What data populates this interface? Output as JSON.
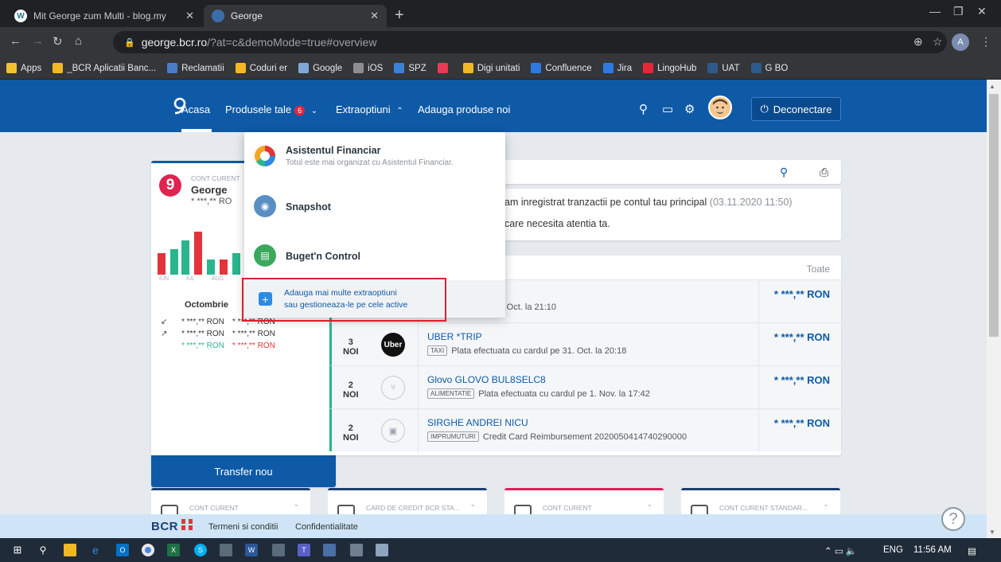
{
  "browser": {
    "tabs": [
      {
        "title": "Mit George zum Multi - blog.my",
        "active": false
      },
      {
        "title": "George",
        "active": true
      }
    ],
    "url_host": "george.bcr.ro",
    "url_path": "/?at=c&demoMode=true#overview",
    "profile_initial": "A",
    "bookmarks": [
      {
        "label": "Apps",
        "color": "#f1c232"
      },
      {
        "label": "_BCR Aplicatii Banc...",
        "color": "#f2b824"
      },
      {
        "label": "Reclamatii",
        "color": "#4a7cc9"
      },
      {
        "label": "Coduri er",
        "color": "#f2b824"
      },
      {
        "label": "Google",
        "color": "#7fa8d8"
      },
      {
        "label": "iOS",
        "color": "#8e8e8e"
      },
      {
        "label": "SPZ",
        "color": "#3b82d6"
      },
      {
        "label": "",
        "color": "#e83a55"
      },
      {
        "label": "Digi unitati",
        "color": "#f2b824"
      },
      {
        "label": "Confluence",
        "color": "#2d7be0"
      },
      {
        "label": "Jira",
        "color": "#2d7be0"
      },
      {
        "label": "LingoHub",
        "color": "#e8263a"
      },
      {
        "label": "UAT",
        "color": "#2d5a8a"
      },
      {
        "label": "G BO",
        "color": "#2d5a8a"
      }
    ]
  },
  "header": {
    "nav": {
      "home": "Acasa",
      "products": "Produsele tale",
      "products_badge": "6",
      "extras": "Extraoptiuni",
      "add_products": "Adauga produse noi"
    },
    "logout": "Deconectare"
  },
  "dropdown": {
    "items": [
      {
        "title": "Asistentul Financiar",
        "desc": "Totul este mai organizat cu Asistentul Financiar."
      },
      {
        "title": "Snapshot",
        "desc": ""
      },
      {
        "title": "Buget'n Control",
        "desc": ""
      }
    ],
    "add_line1": "Adauga mai multe extraoptiuni",
    "add_line2": "sau gestioneaza-le pe cele active"
  },
  "account": {
    "type": "CONT CURENT",
    "name": "George",
    "balance": "* ***,** RO",
    "months": [
      "IUN",
      "IUL",
      "AUG"
    ],
    "bars": [
      {
        "color": "#e2343a",
        "height": 0.5
      },
      {
        "color": "#2ab58e",
        "height": 0.6
      },
      {
        "color": "#2ab58e",
        "height": 0.8
      },
      {
        "color": "#e2343a",
        "height": 1.0
      },
      {
        "color": "#2ab58e",
        "height": 0.35
      },
      {
        "color": "#e2343a",
        "height": 0.35
      },
      {
        "color": "#2ab58e",
        "height": 0.5
      }
    ],
    "summary_month": "Octombrie",
    "summary_rows": [
      {
        "arrow": "↙",
        "in": "* ***,** RON",
        "out": "* ***,** RON",
        "color_in": "#333",
        "color_out": "#333"
      },
      {
        "arrow": "↗",
        "in": "* ***,** RON",
        "out": "* ***,** RON",
        "color_in": "#333",
        "color_out": "#333"
      },
      {
        "arrow": "",
        "in": "* ***,** RON",
        "out": "* ***,** RON",
        "color_in": "#2ab58e",
        "color_out": "#e2343a"
      }
    ],
    "transfer_button": "Transfer nou"
  },
  "notice": {
    "line1": "am inregistrat tranzactii pe contul tau principal",
    "line1_date": "(03.11.2020 11:50)",
    "line2": "care necesita atentia ta."
  },
  "transactions": {
    "all_link": "Toate",
    "rows": [
      {
        "day": "",
        "label": "",
        "title": "",
        "tag": "",
        "desc": "ata cu cardul pe 31. Oct. la 21:10",
        "amount": "* ***,** RON",
        "icon": ""
      },
      {
        "day": "3",
        "label": "NOI",
        "title": "UBER *TRIP",
        "tag": "TAXI",
        "desc": "Plata efectuata cu cardul pe 31. Oct. la 20:18",
        "amount": "* ***,** RON",
        "icon": "Uber"
      },
      {
        "day": "2",
        "label": "NOI",
        "title": "Glovo GLOVO BUL8SELC8",
        "tag": "ALIMENTATIE",
        "desc": "Plata efectuata cu cardul pe 1. Nov. la 17:42",
        "amount": "* ***,** RON",
        "icon": "food"
      },
      {
        "day": "2",
        "label": "NOI",
        "title": "SIRGHE ANDREI NICU",
        "tag": "IMPRUMUTURI",
        "desc": "Credit Card Reimbursement 2020050414740290000",
        "amount": "* ***,** RON",
        "icon": "loan"
      }
    ]
  },
  "bottom_cards": [
    {
      "label": "CONT CURENT",
      "color": "#1d3f6e"
    },
    {
      "label": "CARD DE CREDIT BCR STA...",
      "color": "#1d3f6e"
    },
    {
      "label": "CONT CURENT",
      "color": "#d6245a"
    },
    {
      "label": "CONT CURENT STANDAR...",
      "color": "#1d3f6e"
    }
  ],
  "footer": {
    "brand": "BCR",
    "terms": "Termeni si conditii",
    "privacy": "Confidentialitate"
  },
  "taskbar": {
    "lang": "ENG",
    "time": "11:56 AM"
  }
}
